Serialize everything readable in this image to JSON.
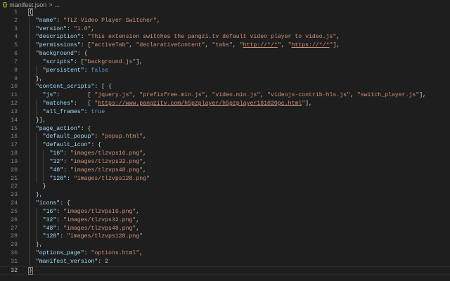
{
  "breadcrumb": {
    "icon": "json-braces-icon",
    "icon_text": "{}",
    "file": "manifest.json",
    "separator": ">",
    "more": "..."
  },
  "editor": {
    "current_line": 32,
    "lines": [
      [
        [
          "bm",
          "{"
        ]
      ],
      [
        [
          "p",
          "  "
        ],
        [
          "k",
          "\"name\""
        ],
        [
          "p",
          ": "
        ],
        [
          "s",
          "\"TLZ Video Player Switcher\""
        ],
        [
          "p",
          ","
        ]
      ],
      [
        [
          "p",
          "  "
        ],
        [
          "k",
          "\"version\""
        ],
        [
          "p",
          ": "
        ],
        [
          "s",
          "\"1.0\""
        ],
        [
          "p",
          ","
        ]
      ],
      [
        [
          "p",
          "  "
        ],
        [
          "k",
          "\"description\""
        ],
        [
          "p",
          ": "
        ],
        [
          "s",
          "\"This extension switches the pangzi.tv default video player to video.js\""
        ],
        [
          "p",
          ","
        ]
      ],
      [
        [
          "p",
          "  "
        ],
        [
          "k",
          "\"permissions\""
        ],
        [
          "p",
          ": ["
        ],
        [
          "s",
          "\"activeTab\""
        ],
        [
          "p",
          ", "
        ],
        [
          "s",
          "\"declarativeContent\""
        ],
        [
          "p",
          ", "
        ],
        [
          "s",
          "\"tabs\""
        ],
        [
          "p",
          ", "
        ],
        [
          "s",
          "\""
        ],
        [
          "su",
          "http://*/*"
        ],
        [
          "s",
          "\""
        ],
        [
          "p",
          ", "
        ],
        [
          "s",
          "\""
        ],
        [
          "su",
          "https://*/*"
        ],
        [
          "s",
          "\""
        ],
        [
          "p",
          "],"
        ]
      ],
      [
        [
          "p",
          "  "
        ],
        [
          "k",
          "\"background\""
        ],
        [
          "p",
          ": {"
        ]
      ],
      [
        [
          "p",
          "    "
        ],
        [
          "k",
          "\"scripts\""
        ],
        [
          "p",
          ": ["
        ],
        [
          "s",
          "\"background.js\""
        ],
        [
          "p",
          "],"
        ]
      ],
      [
        [
          "p",
          "    "
        ],
        [
          "k",
          "\"persistent\""
        ],
        [
          "p",
          ": "
        ],
        [
          "b",
          "false"
        ]
      ],
      [
        [
          "p",
          "  },"
        ]
      ],
      [
        [
          "p",
          "  "
        ],
        [
          "k",
          "\"content_scripts\""
        ],
        [
          "p",
          ": [ {"
        ]
      ],
      [
        [
          "p",
          "    "
        ],
        [
          "k",
          "\"js\""
        ],
        [
          "p",
          ":        [ "
        ],
        [
          "s",
          "\"jquery.js\""
        ],
        [
          "p",
          ", "
        ],
        [
          "s",
          "\"prefixfree.min.js\""
        ],
        [
          "p",
          ", "
        ],
        [
          "s",
          "\"video.min.js\""
        ],
        [
          "p",
          ", "
        ],
        [
          "s",
          "\"videojs-contrib-hls.js\""
        ],
        [
          "p",
          ", "
        ],
        [
          "s",
          "\"switch_player.js\""
        ],
        [
          "p",
          "],"
        ]
      ],
      [
        [
          "p",
          "    "
        ],
        [
          "k",
          "\"matches\""
        ],
        [
          "p",
          ":   [ "
        ],
        [
          "s",
          "\""
        ],
        [
          "su",
          "https://www.pangzitv.com/h5pzplayer/h5pzplayer181020pc.html"
        ],
        [
          "s",
          "\""
        ],
        [
          "p",
          "],"
        ]
      ],
      [
        [
          "p",
          "    "
        ],
        [
          "k",
          "\"all_frames\""
        ],
        [
          "p",
          ": "
        ],
        [
          "b",
          "true"
        ]
      ],
      [
        [
          "p",
          "  }],"
        ]
      ],
      [
        [
          "p",
          "  "
        ],
        [
          "k",
          "\"page_action\""
        ],
        [
          "p",
          ": {"
        ]
      ],
      [
        [
          "p",
          "    "
        ],
        [
          "k",
          "\"default_popup\""
        ],
        [
          "p",
          ": "
        ],
        [
          "s",
          "\"popup.html\""
        ],
        [
          "p",
          ","
        ]
      ],
      [
        [
          "p",
          "    "
        ],
        [
          "k",
          "\"default_icon\""
        ],
        [
          "p",
          ": {"
        ]
      ],
      [
        [
          "p",
          "      "
        ],
        [
          "k",
          "\"16\""
        ],
        [
          "p",
          ": "
        ],
        [
          "s",
          "\"images/tlzvps16.png\""
        ],
        [
          "p",
          ","
        ]
      ],
      [
        [
          "p",
          "      "
        ],
        [
          "k",
          "\"32\""
        ],
        [
          "p",
          ": "
        ],
        [
          "s",
          "\"images/tlzvps32.png\""
        ],
        [
          "p",
          ","
        ]
      ],
      [
        [
          "p",
          "      "
        ],
        [
          "k",
          "\"48\""
        ],
        [
          "p",
          ": "
        ],
        [
          "s",
          "\"images/tlzvps48.png\""
        ],
        [
          "p",
          ","
        ]
      ],
      [
        [
          "p",
          "      "
        ],
        [
          "k",
          "\"128\""
        ],
        [
          "p",
          ": "
        ],
        [
          "s",
          "\"images/tlzvps128.png\""
        ]
      ],
      [
        [
          "p",
          "    }"
        ]
      ],
      [
        [
          "p",
          "  },"
        ]
      ],
      [
        [
          "p",
          "  "
        ],
        [
          "k",
          "\"icons\""
        ],
        [
          "p",
          ": {"
        ]
      ],
      [
        [
          "p",
          "    "
        ],
        [
          "k",
          "\"16\""
        ],
        [
          "p",
          ": "
        ],
        [
          "s",
          "\"images/tlzvps16.png\""
        ],
        [
          "p",
          ","
        ]
      ],
      [
        [
          "p",
          "    "
        ],
        [
          "k",
          "\"32\""
        ],
        [
          "p",
          ": "
        ],
        [
          "s",
          "\"images/tlzvps32.png\""
        ],
        [
          "p",
          ","
        ]
      ],
      [
        [
          "p",
          "    "
        ],
        [
          "k",
          "\"48\""
        ],
        [
          "p",
          ": "
        ],
        [
          "s",
          "\"images/tlzvps48.png\""
        ],
        [
          "p",
          ","
        ]
      ],
      [
        [
          "p",
          "    "
        ],
        [
          "k",
          "\"128\""
        ],
        [
          "p",
          ": "
        ],
        [
          "s",
          "\"images/tlzvps128.png\""
        ]
      ],
      [
        [
          "p",
          "  },"
        ]
      ],
      [
        [
          "p",
          "  "
        ],
        [
          "k",
          "\"options_page\""
        ],
        [
          "p",
          ": "
        ],
        [
          "s",
          "\"options.html\""
        ],
        [
          "p",
          ","
        ]
      ],
      [
        [
          "p",
          "  "
        ],
        [
          "k",
          "\"manifest_version\""
        ],
        [
          "p",
          ": "
        ],
        [
          "n",
          "2"
        ]
      ],
      [
        [
          "bm",
          "}"
        ]
      ]
    ]
  }
}
